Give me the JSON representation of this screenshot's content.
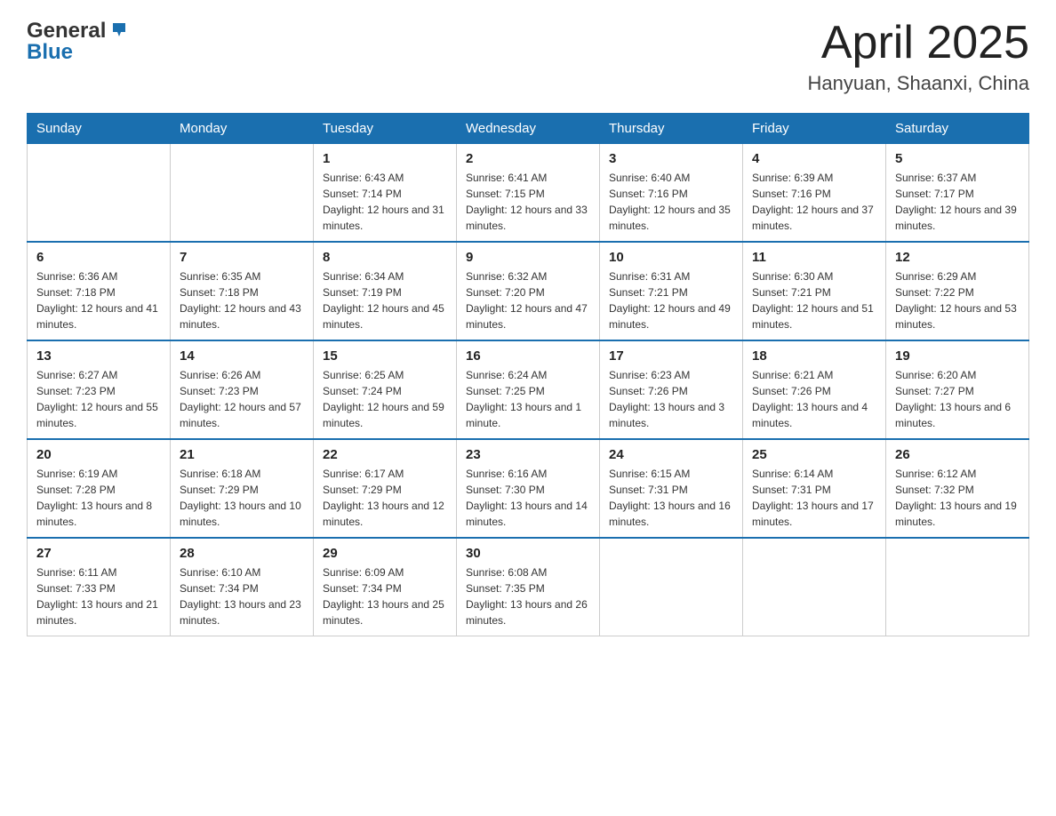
{
  "logo": {
    "text_general": "General",
    "text_blue": "Blue"
  },
  "title": {
    "month_year": "April 2025",
    "location": "Hanyuan, Shaanxi, China"
  },
  "headers": [
    "Sunday",
    "Monday",
    "Tuesday",
    "Wednesday",
    "Thursday",
    "Friday",
    "Saturday"
  ],
  "weeks": [
    [
      {
        "day": "",
        "sunrise": "",
        "sunset": "",
        "daylight": ""
      },
      {
        "day": "",
        "sunrise": "",
        "sunset": "",
        "daylight": ""
      },
      {
        "day": "1",
        "sunrise": "Sunrise: 6:43 AM",
        "sunset": "Sunset: 7:14 PM",
        "daylight": "Daylight: 12 hours and 31 minutes."
      },
      {
        "day": "2",
        "sunrise": "Sunrise: 6:41 AM",
        "sunset": "Sunset: 7:15 PM",
        "daylight": "Daylight: 12 hours and 33 minutes."
      },
      {
        "day": "3",
        "sunrise": "Sunrise: 6:40 AM",
        "sunset": "Sunset: 7:16 PM",
        "daylight": "Daylight: 12 hours and 35 minutes."
      },
      {
        "day": "4",
        "sunrise": "Sunrise: 6:39 AM",
        "sunset": "Sunset: 7:16 PM",
        "daylight": "Daylight: 12 hours and 37 minutes."
      },
      {
        "day": "5",
        "sunrise": "Sunrise: 6:37 AM",
        "sunset": "Sunset: 7:17 PM",
        "daylight": "Daylight: 12 hours and 39 minutes."
      }
    ],
    [
      {
        "day": "6",
        "sunrise": "Sunrise: 6:36 AM",
        "sunset": "Sunset: 7:18 PM",
        "daylight": "Daylight: 12 hours and 41 minutes."
      },
      {
        "day": "7",
        "sunrise": "Sunrise: 6:35 AM",
        "sunset": "Sunset: 7:18 PM",
        "daylight": "Daylight: 12 hours and 43 minutes."
      },
      {
        "day": "8",
        "sunrise": "Sunrise: 6:34 AM",
        "sunset": "Sunset: 7:19 PM",
        "daylight": "Daylight: 12 hours and 45 minutes."
      },
      {
        "day": "9",
        "sunrise": "Sunrise: 6:32 AM",
        "sunset": "Sunset: 7:20 PM",
        "daylight": "Daylight: 12 hours and 47 minutes."
      },
      {
        "day": "10",
        "sunrise": "Sunrise: 6:31 AM",
        "sunset": "Sunset: 7:21 PM",
        "daylight": "Daylight: 12 hours and 49 minutes."
      },
      {
        "day": "11",
        "sunrise": "Sunrise: 6:30 AM",
        "sunset": "Sunset: 7:21 PM",
        "daylight": "Daylight: 12 hours and 51 minutes."
      },
      {
        "day": "12",
        "sunrise": "Sunrise: 6:29 AM",
        "sunset": "Sunset: 7:22 PM",
        "daylight": "Daylight: 12 hours and 53 minutes."
      }
    ],
    [
      {
        "day": "13",
        "sunrise": "Sunrise: 6:27 AM",
        "sunset": "Sunset: 7:23 PM",
        "daylight": "Daylight: 12 hours and 55 minutes."
      },
      {
        "day": "14",
        "sunrise": "Sunrise: 6:26 AM",
        "sunset": "Sunset: 7:23 PM",
        "daylight": "Daylight: 12 hours and 57 minutes."
      },
      {
        "day": "15",
        "sunrise": "Sunrise: 6:25 AM",
        "sunset": "Sunset: 7:24 PM",
        "daylight": "Daylight: 12 hours and 59 minutes."
      },
      {
        "day": "16",
        "sunrise": "Sunrise: 6:24 AM",
        "sunset": "Sunset: 7:25 PM",
        "daylight": "Daylight: 13 hours and 1 minute."
      },
      {
        "day": "17",
        "sunrise": "Sunrise: 6:23 AM",
        "sunset": "Sunset: 7:26 PM",
        "daylight": "Daylight: 13 hours and 3 minutes."
      },
      {
        "day": "18",
        "sunrise": "Sunrise: 6:21 AM",
        "sunset": "Sunset: 7:26 PM",
        "daylight": "Daylight: 13 hours and 4 minutes."
      },
      {
        "day": "19",
        "sunrise": "Sunrise: 6:20 AM",
        "sunset": "Sunset: 7:27 PM",
        "daylight": "Daylight: 13 hours and 6 minutes."
      }
    ],
    [
      {
        "day": "20",
        "sunrise": "Sunrise: 6:19 AM",
        "sunset": "Sunset: 7:28 PM",
        "daylight": "Daylight: 13 hours and 8 minutes."
      },
      {
        "day": "21",
        "sunrise": "Sunrise: 6:18 AM",
        "sunset": "Sunset: 7:29 PM",
        "daylight": "Daylight: 13 hours and 10 minutes."
      },
      {
        "day": "22",
        "sunrise": "Sunrise: 6:17 AM",
        "sunset": "Sunset: 7:29 PM",
        "daylight": "Daylight: 13 hours and 12 minutes."
      },
      {
        "day": "23",
        "sunrise": "Sunrise: 6:16 AM",
        "sunset": "Sunset: 7:30 PM",
        "daylight": "Daylight: 13 hours and 14 minutes."
      },
      {
        "day": "24",
        "sunrise": "Sunrise: 6:15 AM",
        "sunset": "Sunset: 7:31 PM",
        "daylight": "Daylight: 13 hours and 16 minutes."
      },
      {
        "day": "25",
        "sunrise": "Sunrise: 6:14 AM",
        "sunset": "Sunset: 7:31 PM",
        "daylight": "Daylight: 13 hours and 17 minutes."
      },
      {
        "day": "26",
        "sunrise": "Sunrise: 6:12 AM",
        "sunset": "Sunset: 7:32 PM",
        "daylight": "Daylight: 13 hours and 19 minutes."
      }
    ],
    [
      {
        "day": "27",
        "sunrise": "Sunrise: 6:11 AM",
        "sunset": "Sunset: 7:33 PM",
        "daylight": "Daylight: 13 hours and 21 minutes."
      },
      {
        "day": "28",
        "sunrise": "Sunrise: 6:10 AM",
        "sunset": "Sunset: 7:34 PM",
        "daylight": "Daylight: 13 hours and 23 minutes."
      },
      {
        "day": "29",
        "sunrise": "Sunrise: 6:09 AM",
        "sunset": "Sunset: 7:34 PM",
        "daylight": "Daylight: 13 hours and 25 minutes."
      },
      {
        "day": "30",
        "sunrise": "Sunrise: 6:08 AM",
        "sunset": "Sunset: 7:35 PM",
        "daylight": "Daylight: 13 hours and 26 minutes."
      },
      {
        "day": "",
        "sunrise": "",
        "sunset": "",
        "daylight": ""
      },
      {
        "day": "",
        "sunrise": "",
        "sunset": "",
        "daylight": ""
      },
      {
        "day": "",
        "sunrise": "",
        "sunset": "",
        "daylight": ""
      }
    ]
  ]
}
